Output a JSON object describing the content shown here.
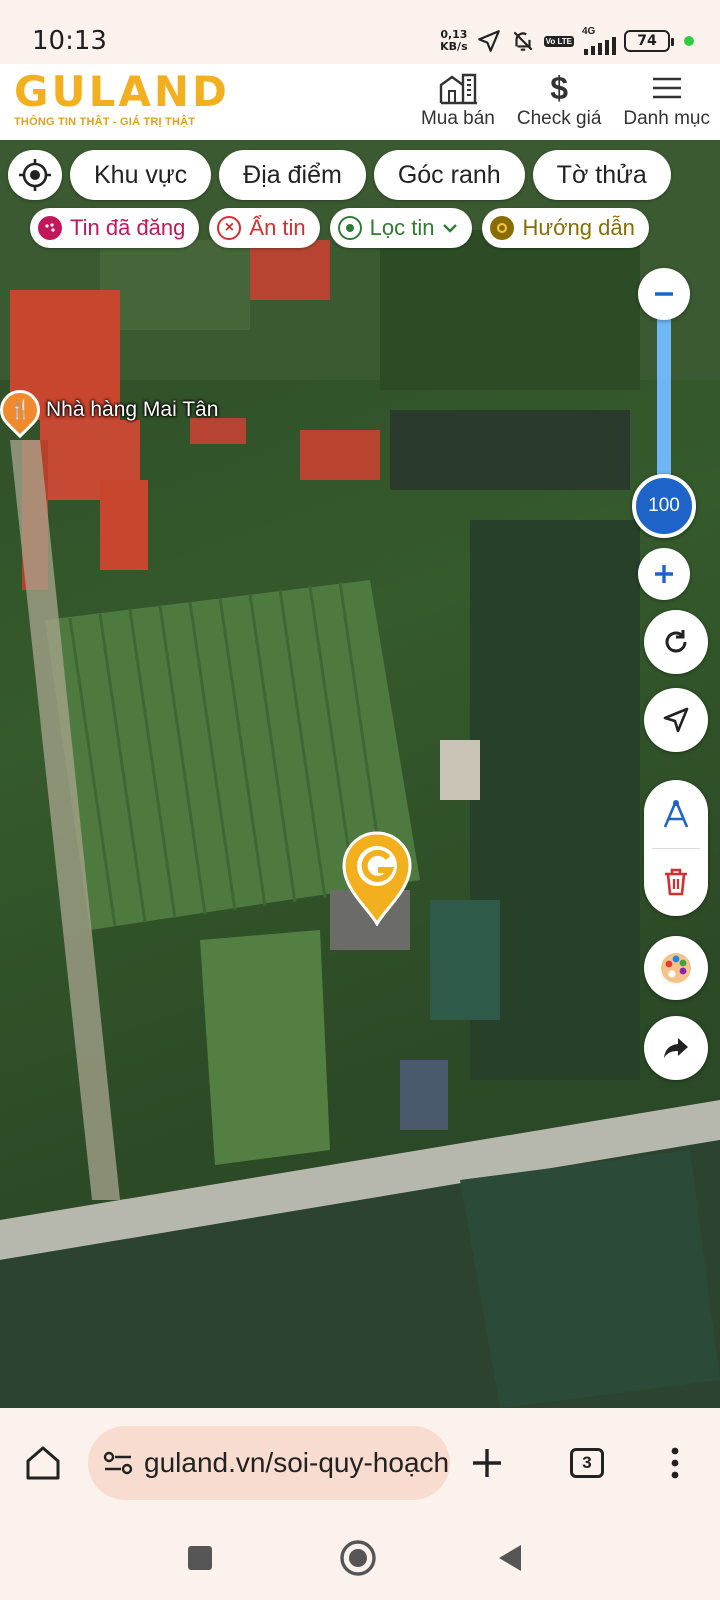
{
  "status_bar": {
    "time": "10:13",
    "net_speed_value": "0,13",
    "net_speed_unit": "KB/s",
    "volte": "Vo LTE",
    "network": "4G",
    "battery": "74"
  },
  "header": {
    "logo_text": "GULAND",
    "tagline": "THÔNG TIN THẬT - GIÁ TRỊ THẬT",
    "nav": [
      {
        "label": "Mua bán",
        "icon": "building-icon"
      },
      {
        "label": "Check giá",
        "icon": "dollar-icon"
      },
      {
        "label": "Danh mục",
        "icon": "menu-icon"
      }
    ]
  },
  "map_filters": {
    "pills": [
      "Khu vực",
      "Địa điểm",
      "Góc ranh",
      "Tờ thửa"
    ],
    "chips": [
      {
        "label": "Tin đã đăng",
        "icon": "palette-icon",
        "color": "#c2185b"
      },
      {
        "label": "Ẩn tin",
        "icon": "close-circle-icon",
        "color": "#d32f2f"
      },
      {
        "label": "Lọc tin",
        "icon": "location-icon",
        "color": "#2e7d32"
      },
      {
        "label": "Hướng dẫn",
        "icon": "play-circle-icon",
        "color": "#8a6d00"
      }
    ]
  },
  "map": {
    "poi_label": "Nhà hàng Mai Tân",
    "poi_icon": "restaurant-icon",
    "zoom_level": "100",
    "marker_icon": "guland-pin-icon"
  },
  "browser": {
    "url": "guland.vn/soi-quy-hoạch",
    "tab_count": "3"
  },
  "colors": {
    "brand": "#f2b01e",
    "zoom_blue": "#1e64c8",
    "zoom_track": "#6fb6f5",
    "url_bg": "#f7dccf"
  }
}
